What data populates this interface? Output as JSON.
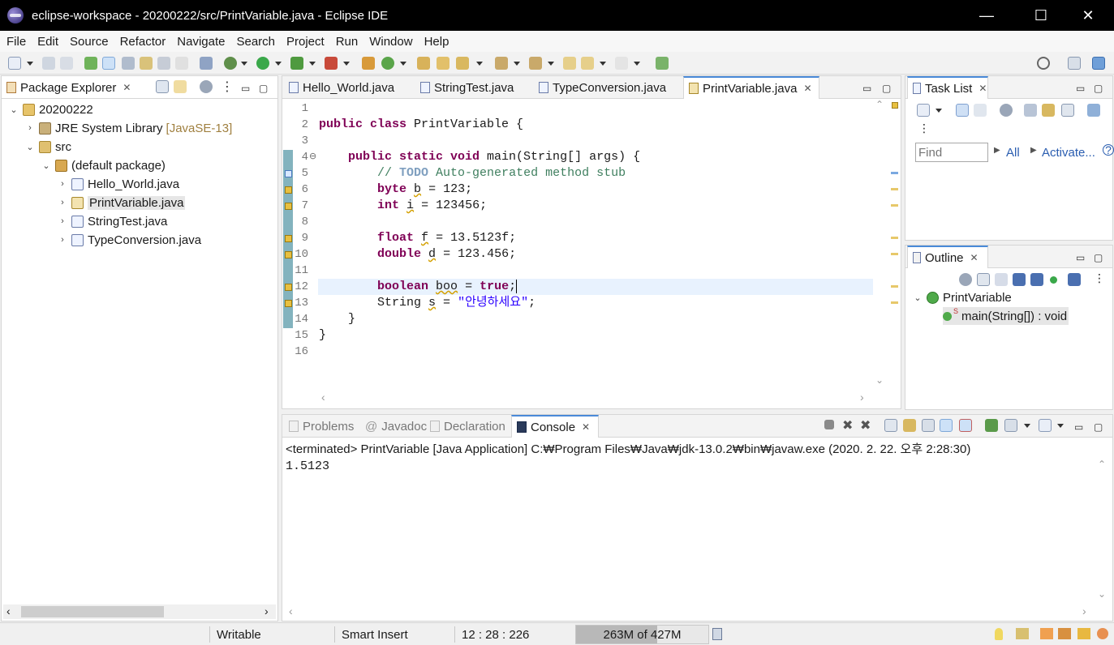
{
  "window": {
    "title": "eclipse-workspace - 20200222/src/PrintVariable.java - Eclipse IDE",
    "minimize": "—",
    "maximize": "☐",
    "close": "✕"
  },
  "menu": [
    "File",
    "Edit",
    "Source",
    "Refactor",
    "Navigate",
    "Search",
    "Project",
    "Run",
    "Window",
    "Help"
  ],
  "package_explorer": {
    "tab_label": "Package Explorer",
    "project": "20200222",
    "jre_label": "JRE System Library",
    "jre_version": "[JavaSE-13]",
    "src": "src",
    "package": "(default package)",
    "files": [
      "Hello_World.java",
      "PrintVariable.java",
      "StringTest.java",
      "TypeConversion.java"
    ],
    "selected_file": "PrintVariable.java"
  },
  "editor": {
    "tabs": [
      "Hello_World.java",
      "StringTest.java",
      "TypeConversion.java",
      "PrintVariable.java"
    ],
    "active_tab": "PrintVariable.java",
    "line_numbers": [
      "1",
      "2",
      "3",
      "4",
      "5",
      "6",
      "7",
      "8",
      "9",
      "10",
      "11",
      "12",
      "13",
      "14",
      "15",
      "16"
    ],
    "code": {
      "l2_kw": "public class",
      "l2_rest": " PrintVariable {",
      "l4_indent": "    ",
      "l4_kw": "public static void",
      "l4_rest": " main(String[] args) {",
      "l5_indent": "        ",
      "l5_comment": "// ",
      "l5_todo": "TODO",
      "l5_rest": " Auto-generated method stub",
      "l6_kw": "byte",
      "l6_var": "b",
      "l6_rest": " = 123;",
      "l7_kw": "int",
      "l7_var": "i",
      "l7_rest": " = 123456;",
      "l9_kw": "float",
      "l9_var": "f",
      "l9_rest": " = 13.5123f;",
      "l10_kw": "double",
      "l10_var": "d",
      "l10_rest": " = 123.456;",
      "l12_kw": "boolean",
      "l12_var": "boo",
      "l12_eq": " = ",
      "l12_true": "true",
      "l12_semi": ";",
      "l13_type": "String ",
      "l13_var": "s",
      "l13_eq": " = ",
      "l13_str": "\"안녕하세요\"",
      "l13_semi": ";",
      "l14": "    }",
      "l15": "}"
    }
  },
  "task_list": {
    "tab_label": "Task List",
    "find_placeholder": "Find",
    "all_label": "All",
    "activate_label": "Activate...",
    "help": "?"
  },
  "outline": {
    "tab_label": "Outline",
    "class_name": "PrintVariable",
    "method": "main(String[]) : void",
    "static_marker": "S"
  },
  "console": {
    "tabs": [
      "Problems",
      "Javadoc",
      "Declaration",
      "Console"
    ],
    "active_tab": "Console",
    "header": "<terminated> PrintVariable [Java Application] C:₩Program Files₩Java₩jdk-13.0.2₩bin₩javaw.exe (2020. 2. 22. 오후 2:28:30)",
    "output": "1.5123"
  },
  "status": {
    "writable": "Writable",
    "insert_mode": "Smart Insert",
    "position": "12 : 28 : 226",
    "heap": "263M of 427M",
    "heap_fraction": 0.616
  },
  "colors": {
    "keyword": "#7f0055",
    "comment": "#3f7f5f",
    "string": "#2a00ff",
    "active_tab_border": "#4a8ad8"
  }
}
